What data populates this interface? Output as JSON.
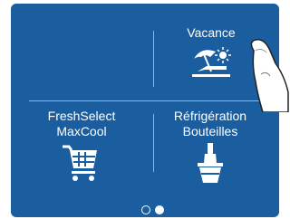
{
  "menu": {
    "vacance_label": "Vacance",
    "freshselect_line1": "FreshSelect",
    "freshselect_line2": "MaxCool",
    "refrigeration_line1": "Réfrigération",
    "refrigeration_line2": "Bouteilles"
  },
  "pagination": {
    "total_pages": 2,
    "current_page": 2
  },
  "icons": {
    "vacance": "beach-umbrella-sun-icon",
    "freshselect": "shopping-cart-icon",
    "refrigeration": "bottle-in-bucket-icon"
  },
  "colors": {
    "background": "#1a5ea0",
    "foreground": "#ffffff"
  }
}
